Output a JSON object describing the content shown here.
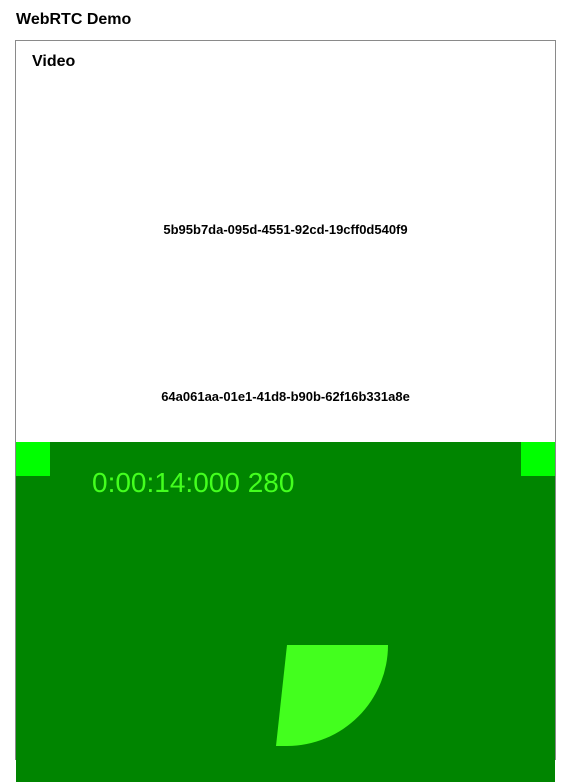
{
  "page": {
    "title": "WebRTC Demo"
  },
  "video_panel": {
    "legend": "Video",
    "peer_ids": [
      "5b95b7da-095d-4551-92cd-19cff0d540f9",
      "64a061aa-01e1-41d8-b90b-62f16b331a8e"
    ],
    "stream": {
      "timecode": "0:00:14:000 280",
      "background_color": "#008500",
      "marker_color": "#00ff00",
      "sweep_color": "#43ff1e"
    }
  }
}
